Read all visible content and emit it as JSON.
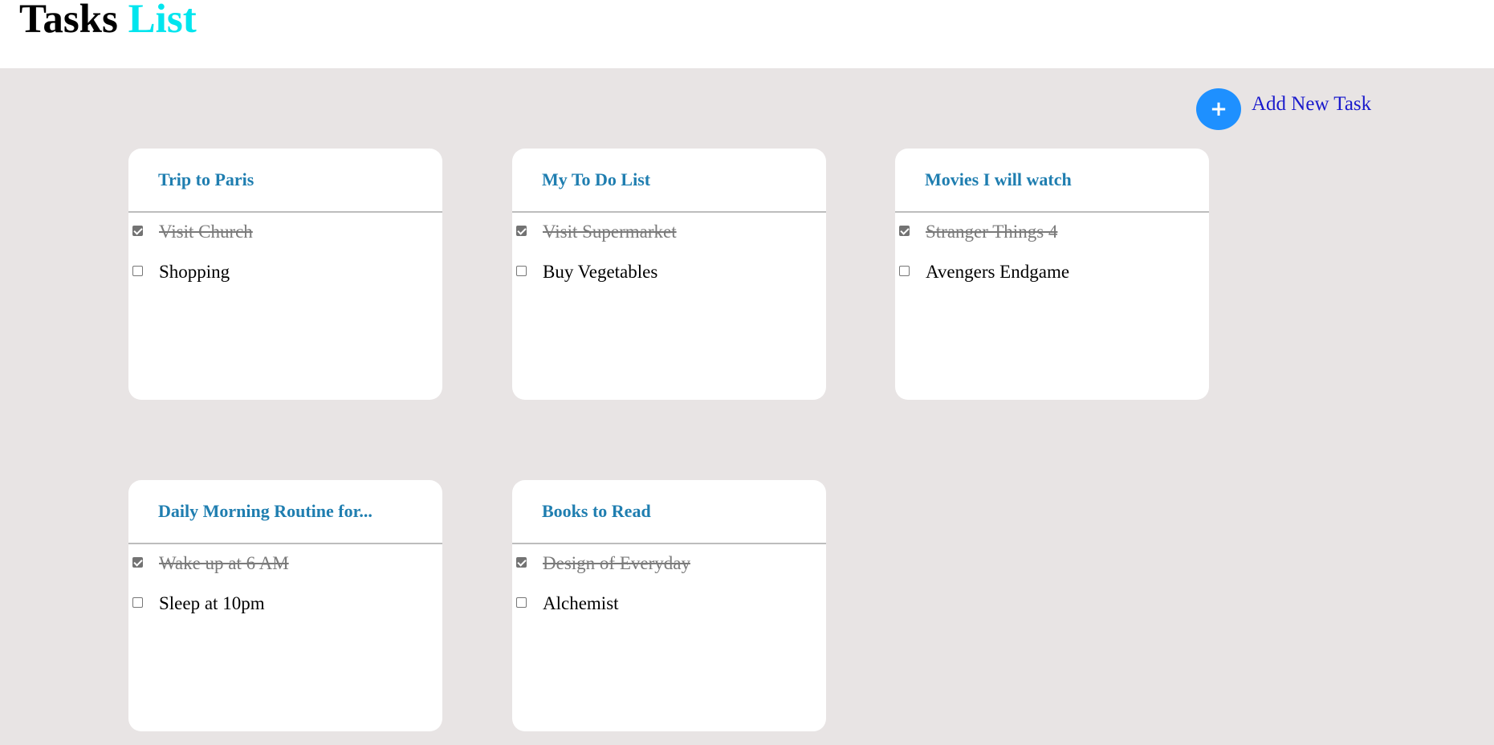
{
  "app": {
    "title_part1": "Tasks",
    "title_part2": "List"
  },
  "add_task": {
    "icon": "plus-icon",
    "label": "Add New Task"
  },
  "cards": [
    {
      "title": "Trip to Paris",
      "tasks": [
        {
          "text": "Visit Church",
          "done": true
        },
        {
          "text": "Shopping",
          "done": false
        }
      ]
    },
    {
      "title": "My To Do List",
      "tasks": [
        {
          "text": "Visit Supermarket",
          "done": true
        },
        {
          "text": "Buy Vegetables",
          "done": false
        }
      ]
    },
    {
      "title": "Movies I will watch",
      "tasks": [
        {
          "text": "Stranger Things 4",
          "done": true
        },
        {
          "text": "Avengers Endgame",
          "done": false
        }
      ]
    },
    {
      "title": "Daily Morning Routine for...",
      "tasks": [
        {
          "text": "Wake up at 6 AM",
          "done": true
        },
        {
          "text": "Sleep at 10pm",
          "done": false
        }
      ]
    },
    {
      "title": "Books to Read",
      "tasks": [
        {
          "text": "Design of Everyday",
          "done": true
        },
        {
          "text": "Alchemist",
          "done": false
        }
      ]
    }
  ],
  "colors": {
    "title_accent": "#00e5ee",
    "card_title": "#1f7eb0",
    "add_button": "#1e90ff",
    "add_label": "#1a1acc",
    "background": "#e8e4e4"
  }
}
